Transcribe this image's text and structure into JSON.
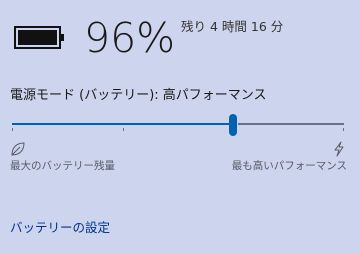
{
  "battery": {
    "percent_text": "96%",
    "remaining_text": "残り 4 時間 16 分",
    "charge_level": 0.96
  },
  "power_mode": {
    "label": "電源モード (バッテリー): 高パフォーマンス",
    "slider_level": 0.67,
    "min_caption": "最大のバッテリー残量",
    "max_caption": "最も高いパフォーマンス"
  },
  "links": {
    "battery_settings": "バッテリーの設定"
  },
  "icons": {
    "battery": "battery-icon",
    "leaf": "leaf-icon",
    "bolt": "lightning-bolt-icon"
  },
  "colors": {
    "accent": "#0063b1",
    "link": "#00328c",
    "background": "#cdd4ed"
  }
}
